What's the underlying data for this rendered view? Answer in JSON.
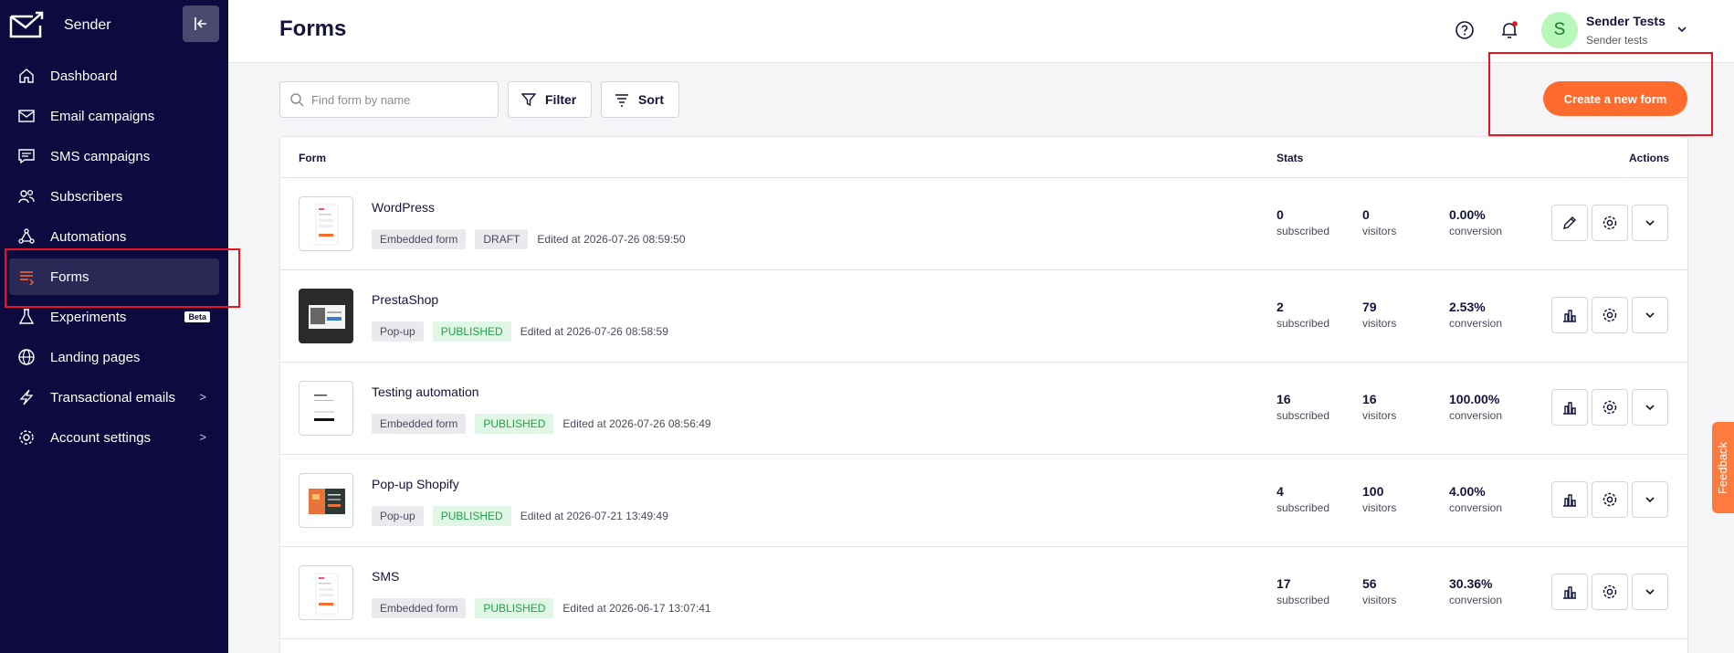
{
  "app": {
    "name": "Sender"
  },
  "sidebar": {
    "items": [
      {
        "label": "Dashboard",
        "icon": "home-icon"
      },
      {
        "label": "Email campaigns",
        "icon": "envelope-icon"
      },
      {
        "label": "SMS campaigns",
        "icon": "chat-icon"
      },
      {
        "label": "Subscribers",
        "icon": "users-icon"
      },
      {
        "label": "Automations",
        "icon": "workflow-icon"
      },
      {
        "label": "Forms",
        "icon": "form-icon",
        "active": true
      },
      {
        "label": "Experiments",
        "icon": "flask-icon",
        "badge": "Beta"
      },
      {
        "label": "Landing pages",
        "icon": "globe-icon"
      },
      {
        "label": "Transactional emails",
        "icon": "lightning-icon",
        "chevron": ">"
      },
      {
        "label": "Account settings",
        "icon": "gear-icon",
        "chevron": ">"
      }
    ]
  },
  "header": {
    "title": "Forms",
    "user": {
      "initial": "S",
      "name": "Sender Tests",
      "sub": "Sender tests"
    }
  },
  "toolbar": {
    "search_placeholder": "Find form by name",
    "filter_label": "Filter",
    "sort_label": "Sort",
    "create_label": "Create a new form"
  },
  "table": {
    "columns": {
      "form": "Form",
      "stats": "Stats",
      "actions": "Actions"
    },
    "stat_labels": {
      "subscribed": "subscribed",
      "visitors": "visitors",
      "conversion": "conversion"
    },
    "rows": [
      {
        "name": "WordPress",
        "type": "Embedded form",
        "status": "DRAFT",
        "edited": "Edited at 2026-07-26 08:59:50",
        "subscribed": "0",
        "visitors": "0",
        "conversion": "0.00%"
      },
      {
        "name": "PrestaShop",
        "type": "Pop-up",
        "status": "PUBLISHED",
        "edited": "Edited at 2026-07-26 08:58:59",
        "subscribed": "2",
        "visitors": "79",
        "conversion": "2.53%"
      },
      {
        "name": "Testing automation",
        "type": "Embedded form",
        "status": "PUBLISHED",
        "edited": "Edited at 2026-07-26 08:56:49",
        "subscribed": "16",
        "visitors": "16",
        "conversion": "100.00%"
      },
      {
        "name": "Pop-up Shopify",
        "type": "Pop-up",
        "status": "PUBLISHED",
        "edited": "Edited at 2026-07-21 13:49:49",
        "subscribed": "4",
        "visitors": "100",
        "conversion": "4.00%"
      },
      {
        "name": "SMS",
        "type": "Embedded form",
        "status": "PUBLISHED",
        "edited": "Edited at 2026-06-17 13:07:41",
        "subscribed": "17",
        "visitors": "56",
        "conversion": "30.36%"
      }
    ]
  },
  "feedback": {
    "label": "Feedback"
  },
  "colors": {
    "sidebar": "#0c0a3e",
    "accent": "#ff6b2c",
    "published": "#24a04a",
    "highlight": "#e6151f"
  }
}
